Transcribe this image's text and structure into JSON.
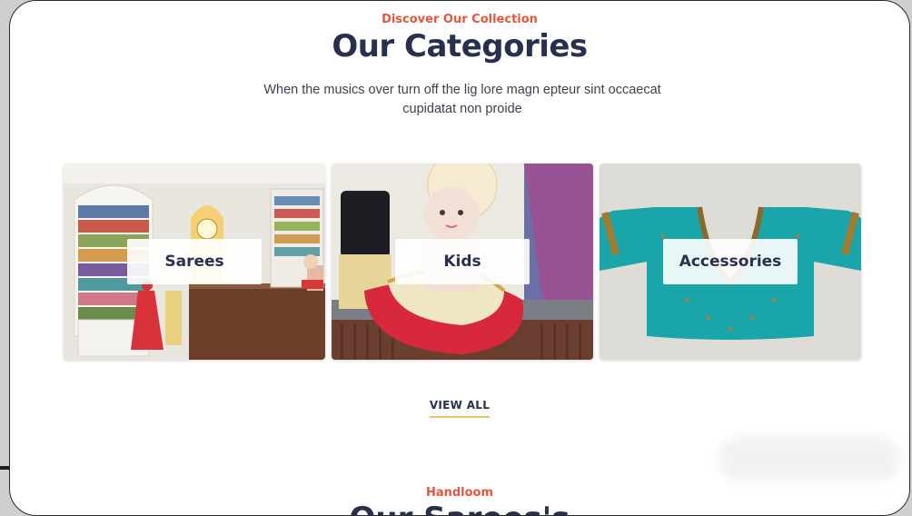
{
  "section": {
    "eyebrow": "Discover Our Collection",
    "title": "Our Categories",
    "subtitle": "When the musics over turn off the lig lore magn epteur sint occaecat cupidatat non proide"
  },
  "categories": [
    {
      "label": "Sarees",
      "image": "saree-store-interior-photo"
    },
    {
      "label": "Kids",
      "image": "kids-dress-mannequin-photo"
    },
    {
      "label": "Accessories",
      "image": "teal-blouse-photo"
    }
  ],
  "view_all_label": "VIEW ALL",
  "next_section": {
    "eyebrow": "Handloom",
    "title": "Our Sarees's"
  },
  "colors": {
    "accent": "#e4553f",
    "heading": "#27304d",
    "underline": "#f0c36a"
  }
}
